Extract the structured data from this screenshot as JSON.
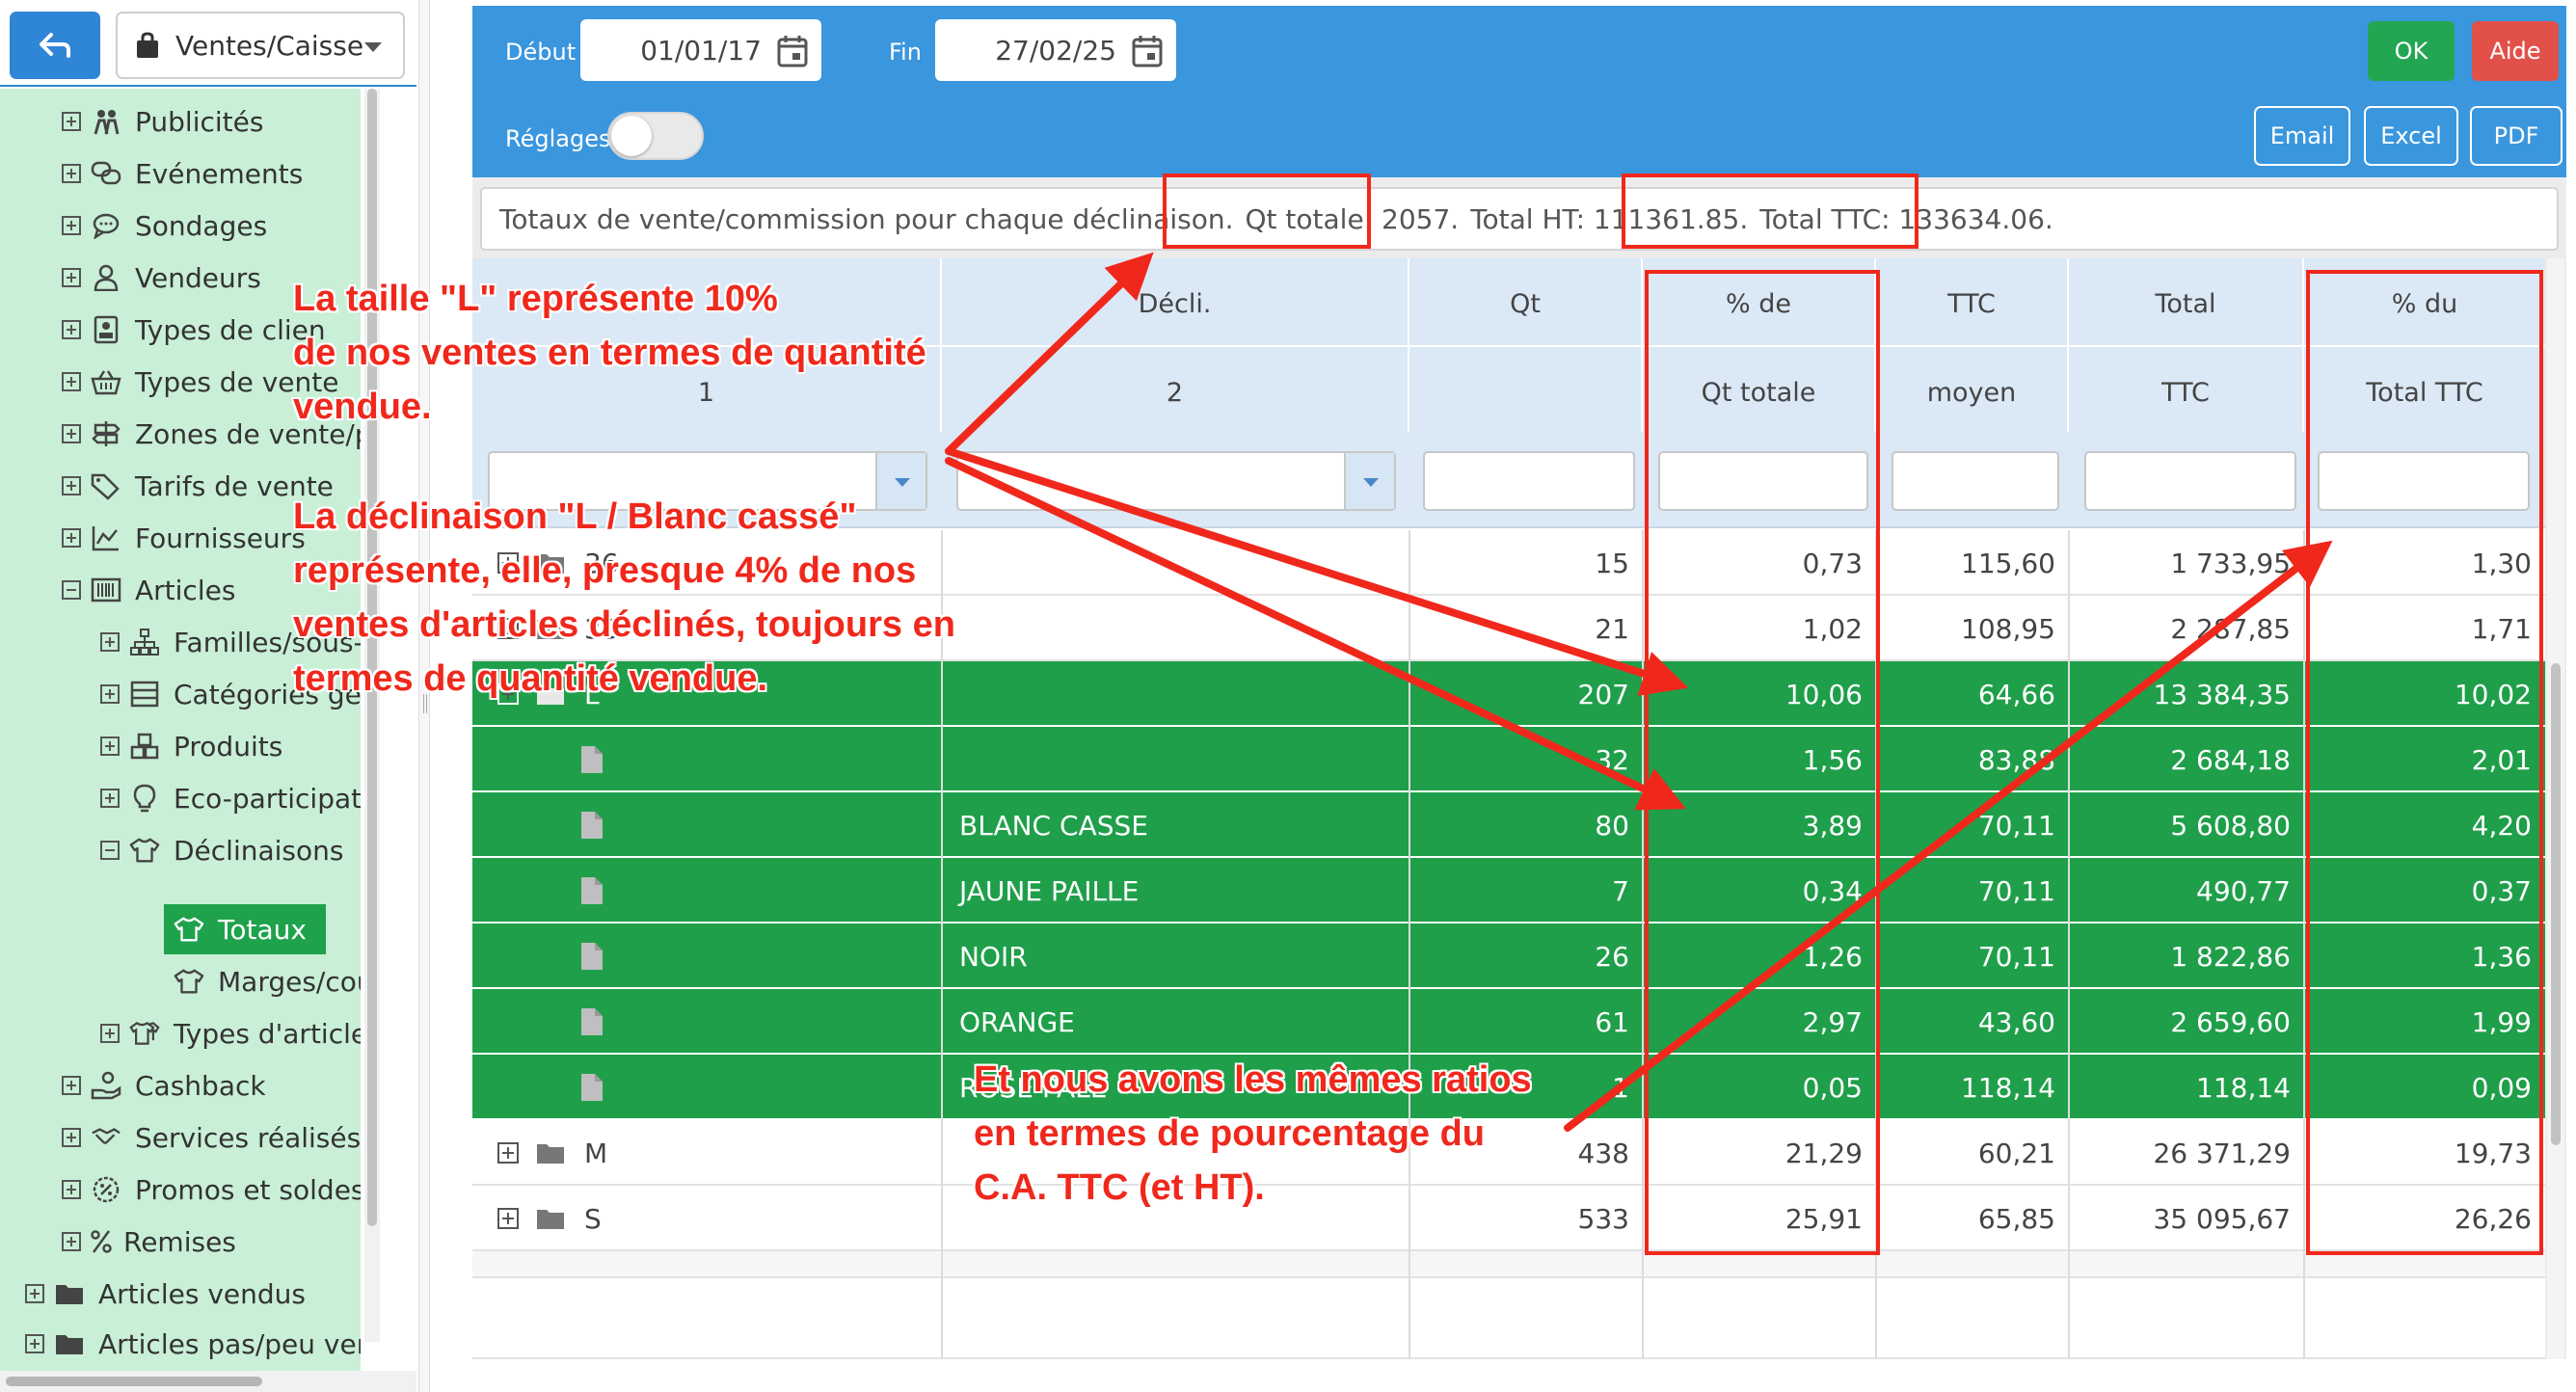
{
  "nav": {
    "module": "Ventes/Caisse",
    "tree": [
      {
        "label": "Publicités",
        "icon": "people-icon"
      },
      {
        "label": "Evénements",
        "icon": "chat-bubbles-icon"
      },
      {
        "label": "Sondages",
        "icon": "chat-bubble-icon"
      },
      {
        "label": "Vendeurs",
        "icon": "user-icon"
      },
      {
        "label": "Types de clien",
        "icon": "contact-card-icon"
      },
      {
        "label": "Types de vente",
        "icon": "basket-icon"
      },
      {
        "label": "Zones de vente/pr",
        "icon": "signpost-icon"
      },
      {
        "label": "Tarifs de vente",
        "icon": "tags-icon"
      },
      {
        "label": "Fournisseurs",
        "icon": "chart-icon"
      },
      {
        "label": "Articles",
        "icon": "barcode-icon"
      },
      {
        "label": "Familles/sous-",
        "icon": "hierarchy-icon"
      },
      {
        "label": "Catégories gén",
        "icon": "list-box-icon"
      },
      {
        "label": "Produits",
        "icon": "boxes-icon"
      },
      {
        "label": "Eco-participatic",
        "icon": "bulb-icon"
      },
      {
        "label": "Déclinaisons",
        "icon": "tshirt-icon"
      },
      {
        "label": "Totaux",
        "icon": "tshirt-icon"
      },
      {
        "label": "Marges/coû",
        "icon": "tshirt-icon"
      },
      {
        "label": "Types d'article",
        "icon": "tshirts-icon"
      },
      {
        "label": "Cashback",
        "icon": "hand-coins-icon"
      },
      {
        "label": "Services réalisés",
        "icon": "handshake-icon"
      },
      {
        "label": "Promos et soldes",
        "icon": "promo-badge-icon"
      },
      {
        "label": "Remises",
        "icon": "percent-icon"
      },
      {
        "label": "Articles vendus",
        "icon": "folder-icon"
      },
      {
        "label": "Articles pas/peu vendu",
        "icon": "folder-icon"
      }
    ]
  },
  "toolbar": {
    "debut_label": "Début",
    "debut_value": "01/01/17",
    "fin_label": "Fin",
    "fin_value": "27/02/25",
    "ok_label": "OK",
    "aide_label": "Aide",
    "reglages_label": "Réglages",
    "email_label": "Email",
    "excel_label": "Excel",
    "pdf_label": "PDF"
  },
  "totals": {
    "prefix": "Totaux de vente/commission pour chaque déclinaison.",
    "qt": "Qt totale: 2057.",
    "ht": "Total HT: 111361.85.",
    "ttc": "Total TTC: 133634.06."
  },
  "columns": [
    {
      "h1": "",
      "h2": "1"
    },
    {
      "h1": "Décli.",
      "h2": "2"
    },
    {
      "h1": "Qt",
      "h2": ""
    },
    {
      "h1": "% de",
      "h2": "Qt totale"
    },
    {
      "h1": "TTC",
      "h2": "moyen"
    },
    {
      "h1": "Total",
      "h2": "TTC"
    },
    {
      "h1": "% du",
      "h2": "Total TTC"
    }
  ],
  "rows": [
    {
      "type": "group",
      "c1": "36",
      "c2": "",
      "qt": "15",
      "pct_qt": "0,73",
      "ttc_moyen": "115,60",
      "total_ttc": "1 733,95",
      "pct_ttc": "1,30"
    },
    {
      "type": "group",
      "c1": "38",
      "c2": "",
      "qt": "21",
      "pct_qt": "1,02",
      "ttc_moyen": "108,95",
      "total_ttc": "2 287,85",
      "pct_ttc": "1,71"
    },
    {
      "type": "group-open",
      "c1": "L",
      "c2": "",
      "qt": "207",
      "pct_qt": "10,06",
      "ttc_moyen": "64,66",
      "total_ttc": "13 384,35",
      "pct_ttc": "10,02"
    },
    {
      "type": "leaf",
      "c1": "",
      "c2": "",
      "qt": "32",
      "pct_qt": "1,56",
      "ttc_moyen": "83,88",
      "total_ttc": "2 684,18",
      "pct_ttc": "2,01"
    },
    {
      "type": "leaf",
      "c1": "",
      "c2": "BLANC CASSE",
      "qt": "80",
      "pct_qt": "3,89",
      "ttc_moyen": "70,11",
      "total_ttc": "5 608,80",
      "pct_ttc": "4,20"
    },
    {
      "type": "leaf",
      "c1": "",
      "c2": "JAUNE PAILLE",
      "qt": "7",
      "pct_qt": "0,34",
      "ttc_moyen": "70,11",
      "total_ttc": "490,77",
      "pct_ttc": "0,37"
    },
    {
      "type": "leaf",
      "c1": "",
      "c2": "NOIR",
      "qt": "26",
      "pct_qt": "1,26",
      "ttc_moyen": "70,11",
      "total_ttc": "1 822,86",
      "pct_ttc": "1,36"
    },
    {
      "type": "leaf",
      "c1": "",
      "c2": "ORANGE",
      "qt": "61",
      "pct_qt": "2,97",
      "ttc_moyen": "43,60",
      "total_ttc": "2 659,60",
      "pct_ttc": "1,99"
    },
    {
      "type": "leaf",
      "c1": "",
      "c2": "ROSE PALE",
      "qt": "1",
      "pct_qt": "0,05",
      "ttc_moyen": "118,14",
      "total_ttc": "118,14",
      "pct_ttc": "0,09"
    },
    {
      "type": "group",
      "c1": "M",
      "c2": "",
      "qt": "438",
      "pct_qt": "21,29",
      "ttc_moyen": "60,21",
      "total_ttc": "26 371,29",
      "pct_ttc": "19,73"
    },
    {
      "type": "group",
      "c1": "S",
      "c2": "",
      "qt": "533",
      "pct_qt": "25,91",
      "ttc_moyen": "65,85",
      "total_ttc": "35 095,67",
      "pct_ttc": "26,26"
    }
  ],
  "annotations": {
    "a1": [
      "La taille \"L\" représente 10%",
      "de nos ventes en termes de quantité",
      "vendue."
    ],
    "a2": [
      "La déclinaison \"L / Blanc cassé\"",
      "représente, elle, presque 4% de nos",
      "ventes d'articles déclinés, toujours en",
      "termes de quantité vendue."
    ],
    "a3": [
      "Et nous avons les mêmes ratios",
      "en termes de pourcentage du",
      "C.A. TTC (et HT)."
    ]
  },
  "colors": {
    "accent": "#3a96dd",
    "row_green": "#1f9f4a",
    "annotation_red": "#f0281c",
    "tree_bg": "#c9efd7"
  }
}
